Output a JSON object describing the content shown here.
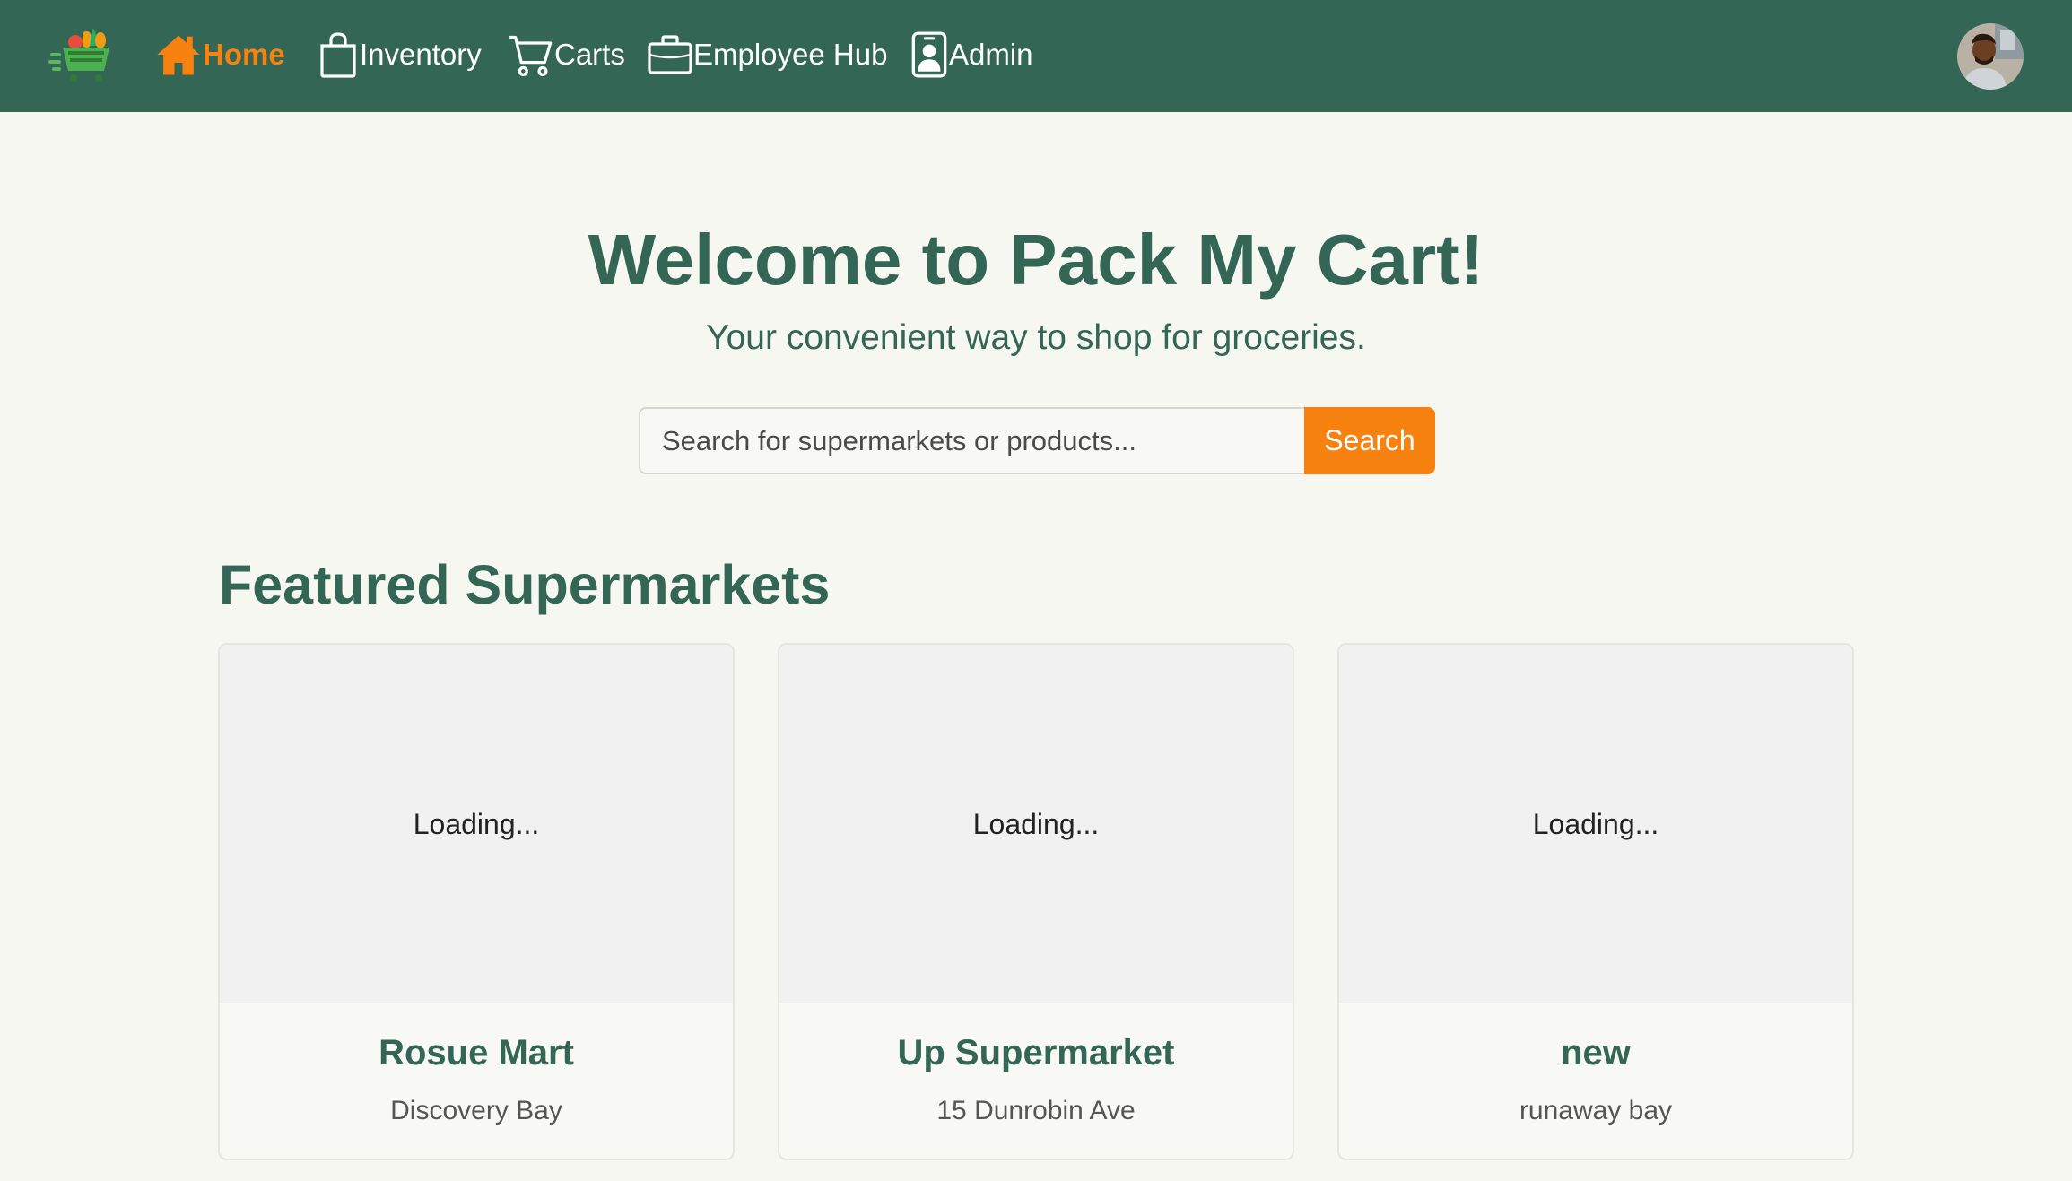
{
  "nav": {
    "home_label": "Home",
    "inventory_label": "Inventory",
    "carts_label": "Carts",
    "employee_hub_label": "Employee Hub",
    "admin_label": "Admin",
    "active": "home"
  },
  "hero": {
    "title": "Welcome to Pack My Cart!",
    "subtitle": "Your convenient way to shop for groceries."
  },
  "search": {
    "placeholder": "Search for supermarkets or products...",
    "value": "",
    "button_label": "Search"
  },
  "featured": {
    "title": "Featured Supermarkets",
    "cards": [
      {
        "image_status": "Loading...",
        "name": "Rosue Mart",
        "address": "Discovery Bay"
      },
      {
        "image_status": "Loading...",
        "name": "Up Supermarket",
        "address": "15 Dunrobin Ave"
      },
      {
        "image_status": "Loading...",
        "name": "new",
        "address": "runaway bay"
      }
    ]
  },
  "colors": {
    "nav_bg": "#336655",
    "accent": "#f7820f",
    "page_bg": "#f7f7f2",
    "heading": "#336655"
  },
  "icons": [
    "cart-logo-icon",
    "home-icon",
    "shopping-bag-icon",
    "shopping-cart-icon",
    "briefcase-icon",
    "id-badge-icon",
    "user-avatar"
  ]
}
